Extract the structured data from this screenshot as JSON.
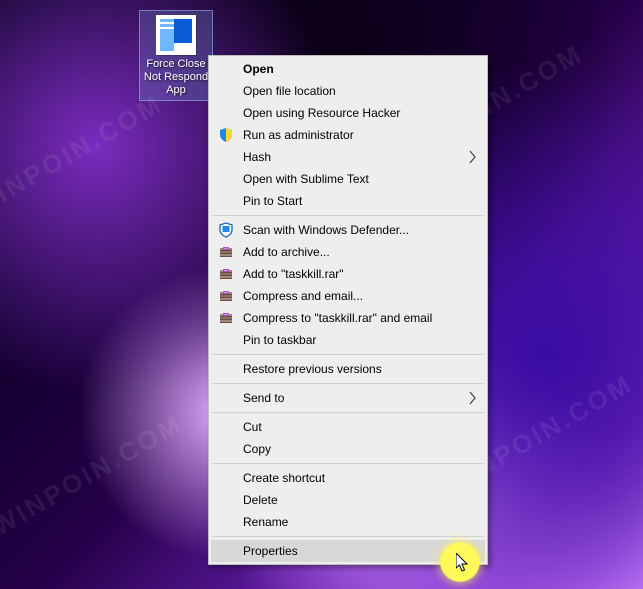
{
  "watermark": "WINPOIN.COM",
  "desktop_icon": {
    "label": "Force Close Not Respond App"
  },
  "menu": {
    "items": [
      {
        "label": "Open",
        "bold": true
      },
      {
        "label": "Open file location"
      },
      {
        "label": "Open using Resource Hacker"
      },
      {
        "label": "Run as administrator",
        "icon": "shield-icon"
      },
      {
        "label": "Hash",
        "submenu": true
      },
      {
        "label": "Open with Sublime Text"
      },
      {
        "label": "Pin to Start"
      },
      {
        "sep": true
      },
      {
        "label": "Scan with Windows Defender...",
        "icon": "defender-icon"
      },
      {
        "label": "Add to archive...",
        "icon": "winrar-icon"
      },
      {
        "label": "Add to \"taskkill.rar\"",
        "icon": "winrar-icon"
      },
      {
        "label": "Compress and email...",
        "icon": "winrar-icon"
      },
      {
        "label": "Compress to \"taskkill.rar\" and email",
        "icon": "winrar-icon"
      },
      {
        "label": "Pin to taskbar"
      },
      {
        "sep": true
      },
      {
        "label": "Restore previous versions"
      },
      {
        "sep": true
      },
      {
        "label": "Send to",
        "submenu": true
      },
      {
        "sep": true
      },
      {
        "label": "Cut"
      },
      {
        "label": "Copy"
      },
      {
        "sep": true
      },
      {
        "label": "Create shortcut"
      },
      {
        "label": "Delete"
      },
      {
        "label": "Rename"
      },
      {
        "sep": true
      },
      {
        "label": "Properties",
        "hover": true
      }
    ]
  }
}
